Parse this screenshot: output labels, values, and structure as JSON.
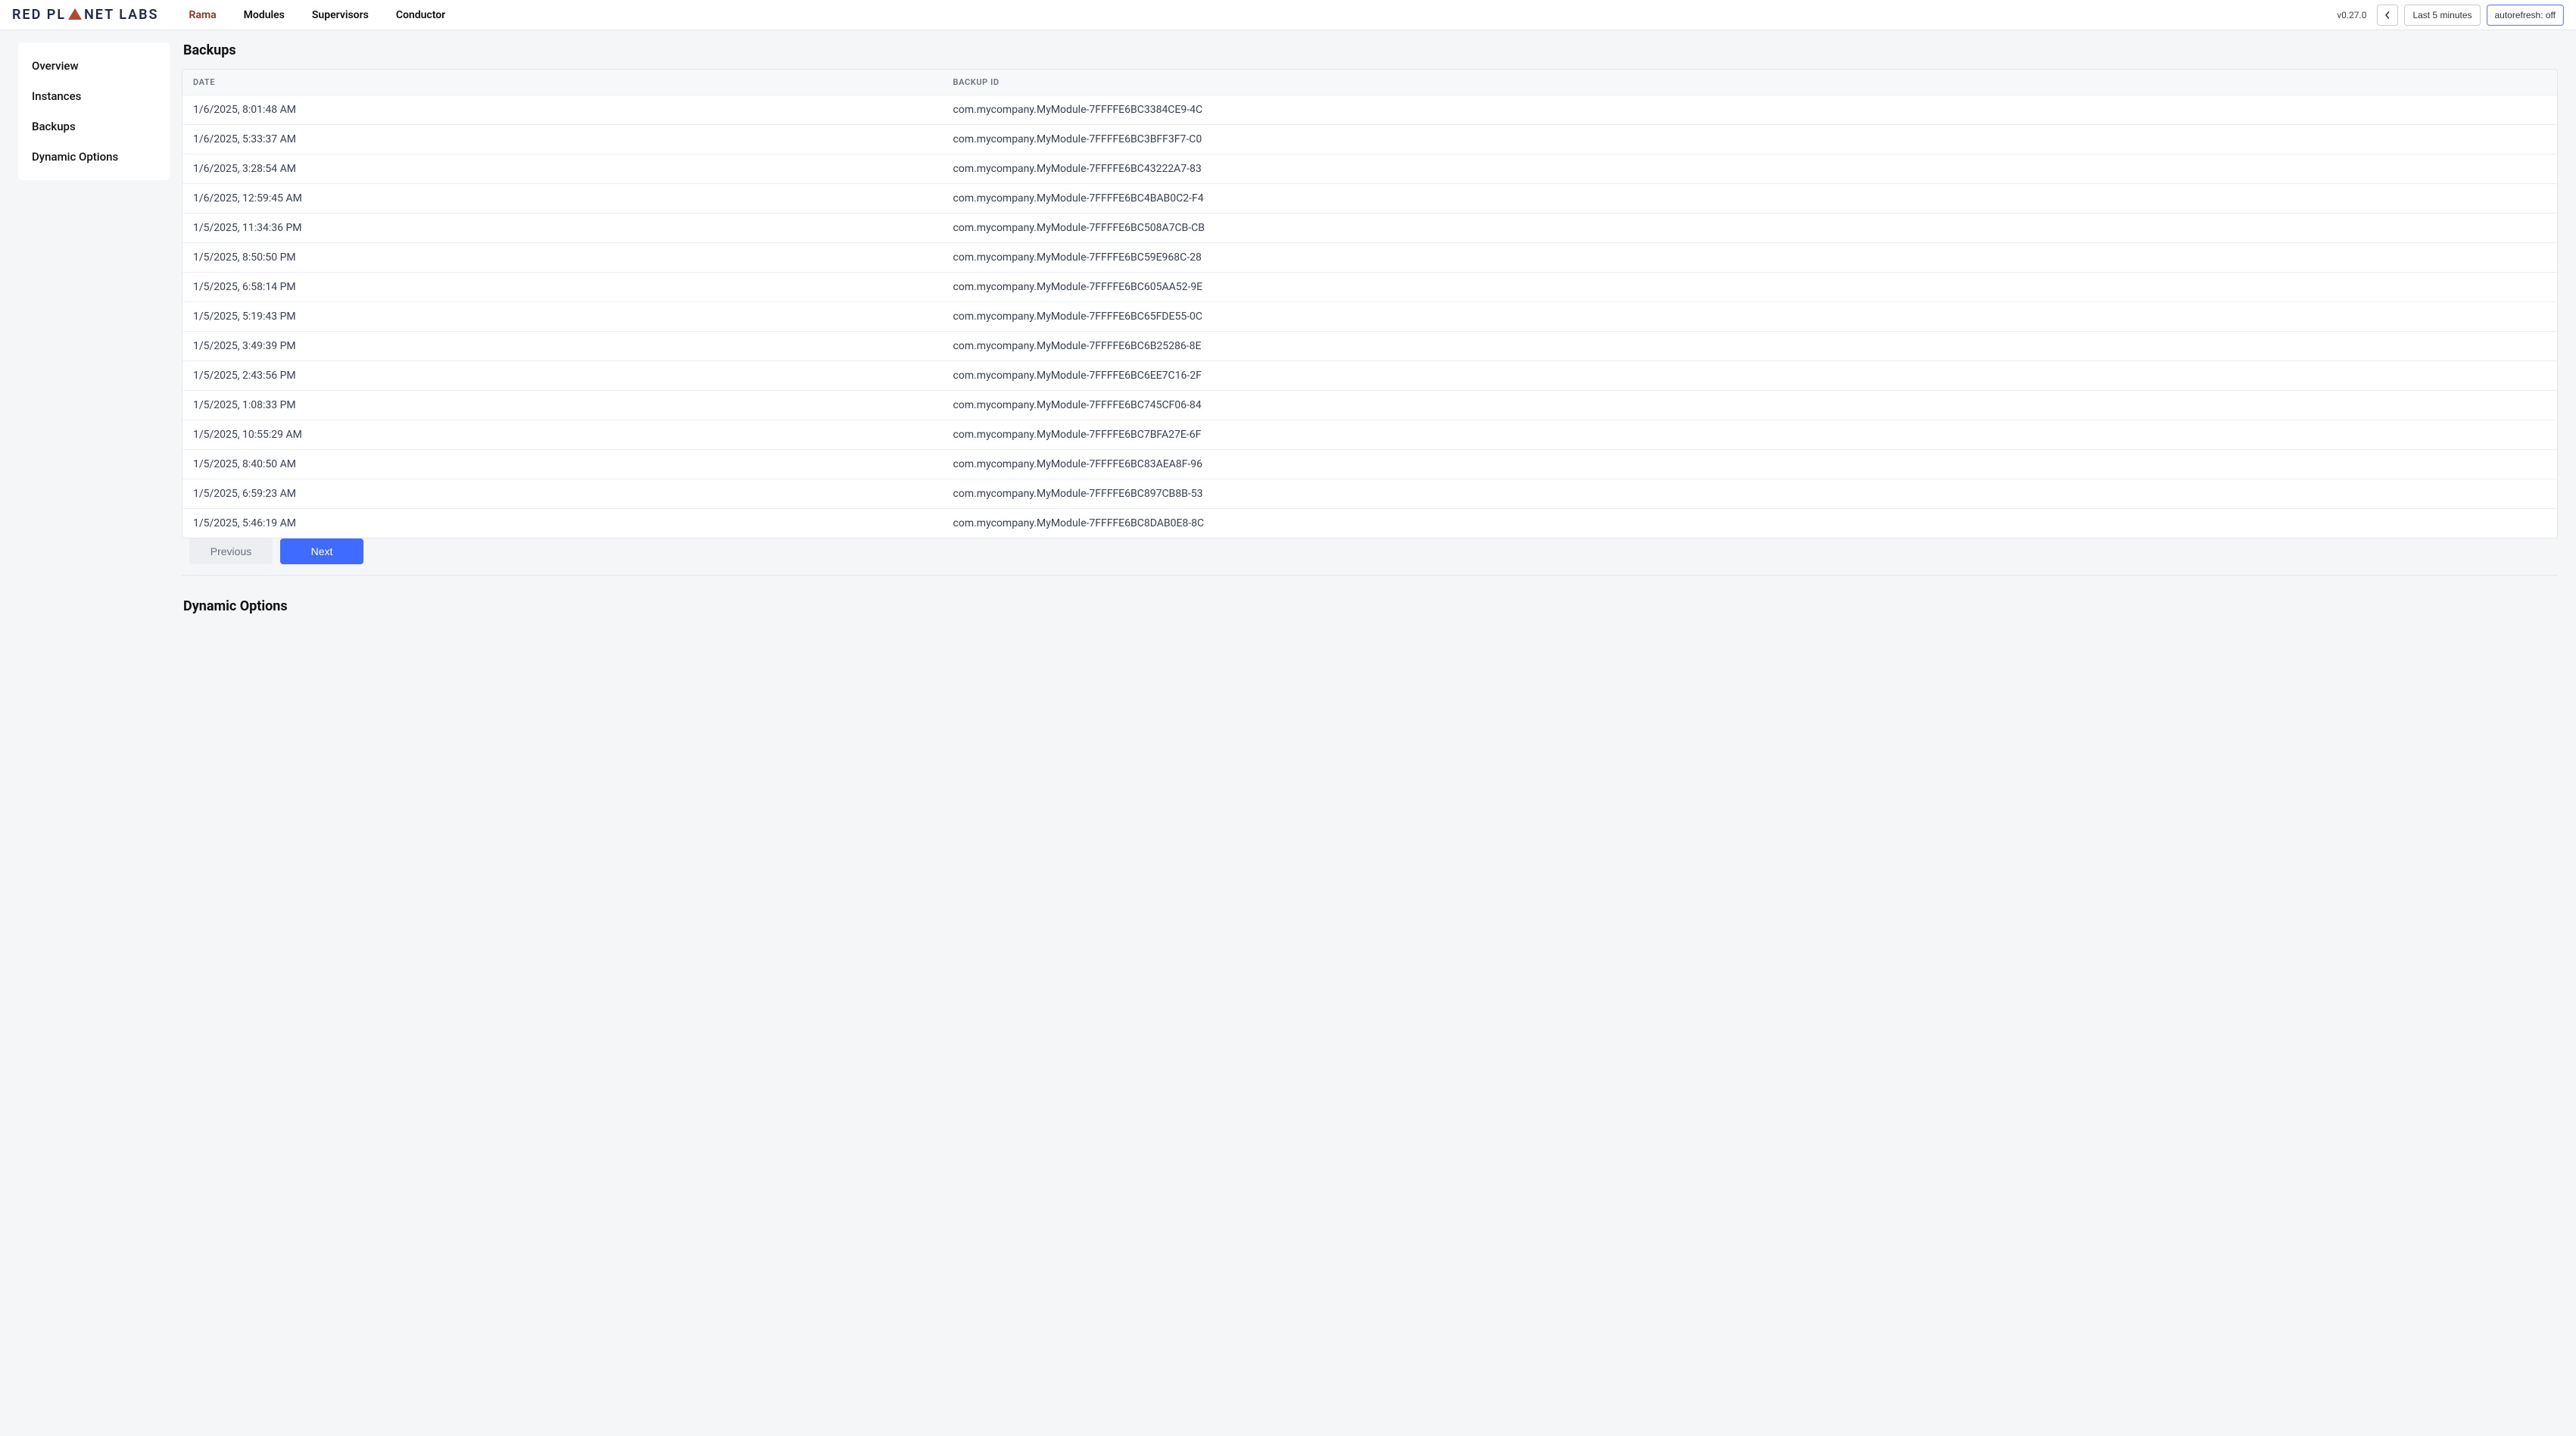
{
  "header": {
    "logo_left": "RED PL",
    "logo_right": "NET LABS",
    "nav": [
      {
        "label": "Rama",
        "active": true
      },
      {
        "label": "Modules",
        "active": false
      },
      {
        "label": "Supervisors",
        "active": false
      },
      {
        "label": "Conductor",
        "active": false
      }
    ],
    "version": "v0.27.0",
    "time_window_label": "Last 5 minutes",
    "autorefresh_label": "autorefresh: off"
  },
  "sidebar": {
    "items": [
      {
        "label": "Overview"
      },
      {
        "label": "Instances"
      },
      {
        "label": "Backups"
      },
      {
        "label": "Dynamic Options"
      }
    ]
  },
  "backups": {
    "title": "Backups",
    "columns": {
      "date": "DATE",
      "backup_id": "BACKUP ID"
    },
    "rows": [
      {
        "date": "1/6/2025, 8:01:48 AM",
        "id": "com.mycompany.MyModule-7FFFFE6BC3384CE9-4C"
      },
      {
        "date": "1/6/2025, 5:33:37 AM",
        "id": "com.mycompany.MyModule-7FFFFE6BC3BFF3F7-C0"
      },
      {
        "date": "1/6/2025, 3:28:54 AM",
        "id": "com.mycompany.MyModule-7FFFFE6BC43222A7-83"
      },
      {
        "date": "1/6/2025, 12:59:45 AM",
        "id": "com.mycompany.MyModule-7FFFFE6BC4BAB0C2-F4"
      },
      {
        "date": "1/5/2025, 11:34:36 PM",
        "id": "com.mycompany.MyModule-7FFFFE6BC508A7CB-CB"
      },
      {
        "date": "1/5/2025, 8:50:50 PM",
        "id": "com.mycompany.MyModule-7FFFFE6BC59E968C-28"
      },
      {
        "date": "1/5/2025, 6:58:14 PM",
        "id": "com.mycompany.MyModule-7FFFFE6BC605AA52-9E"
      },
      {
        "date": "1/5/2025, 5:19:43 PM",
        "id": "com.mycompany.MyModule-7FFFFE6BC65FDE55-0C"
      },
      {
        "date": "1/5/2025, 3:49:39 PM",
        "id": "com.mycompany.MyModule-7FFFFE6BC6B25286-8E"
      },
      {
        "date": "1/5/2025, 2:43:56 PM",
        "id": "com.mycompany.MyModule-7FFFFE6BC6EE7C16-2F"
      },
      {
        "date": "1/5/2025, 1:08:33 PM",
        "id": "com.mycompany.MyModule-7FFFFE6BC745CF06-84"
      },
      {
        "date": "1/5/2025, 10:55:29 AM",
        "id": "com.mycompany.MyModule-7FFFFE6BC7BFA27E-6F"
      },
      {
        "date": "1/5/2025, 8:40:50 AM",
        "id": "com.mycompany.MyModule-7FFFFE6BC83AEA8F-96"
      },
      {
        "date": "1/5/2025, 6:59:23 AM",
        "id": "com.mycompany.MyModule-7FFFFE6BC897CB8B-53"
      },
      {
        "date": "1/5/2025, 5:46:19 AM",
        "id": "com.mycompany.MyModule-7FFFFE6BC8DAB0E8-8C"
      }
    ],
    "pager": {
      "prev": "Previous",
      "next": "Next"
    }
  },
  "dynamic_options": {
    "title": "Dynamic Options"
  }
}
